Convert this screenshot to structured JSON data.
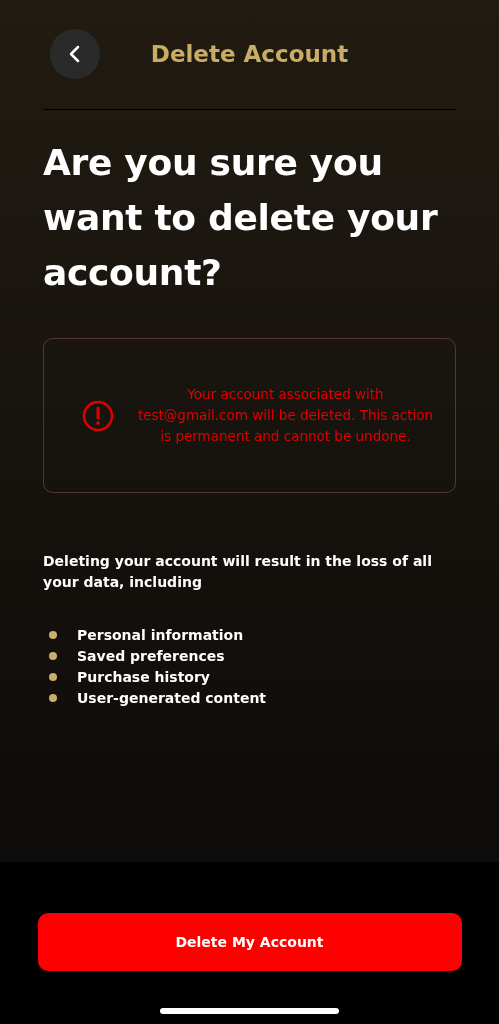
{
  "header": {
    "title": "Delete Account"
  },
  "heading": "Are you sure you want to delete your account?",
  "warning": {
    "message": "Your account associated with test@gmail.com will be deleted. This action is permanent and cannot be undone."
  },
  "intro": "Deleting your account will result in the loss of all your data, including",
  "items": [
    "Personal information",
    "Saved preferences",
    "Purchase history",
    "User-generated content"
  ],
  "button": {
    "label": "Delete My Account"
  }
}
